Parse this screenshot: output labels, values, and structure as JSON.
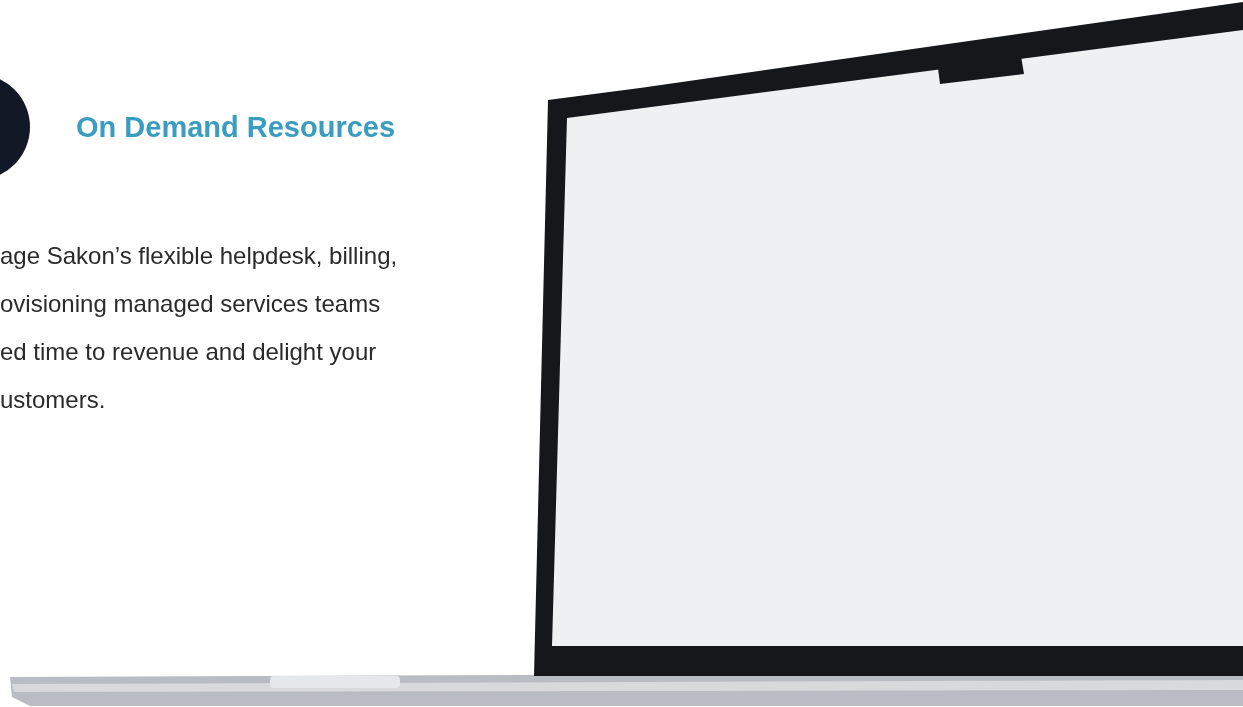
{
  "section": {
    "heading": "On Demand Resources",
    "paragraph_lines": [
      "age Sakon’s flexible helpdesk, billing,",
      "ovisioning managed services teams",
      "ed time to revenue and delight your",
      "ustomers."
    ]
  }
}
